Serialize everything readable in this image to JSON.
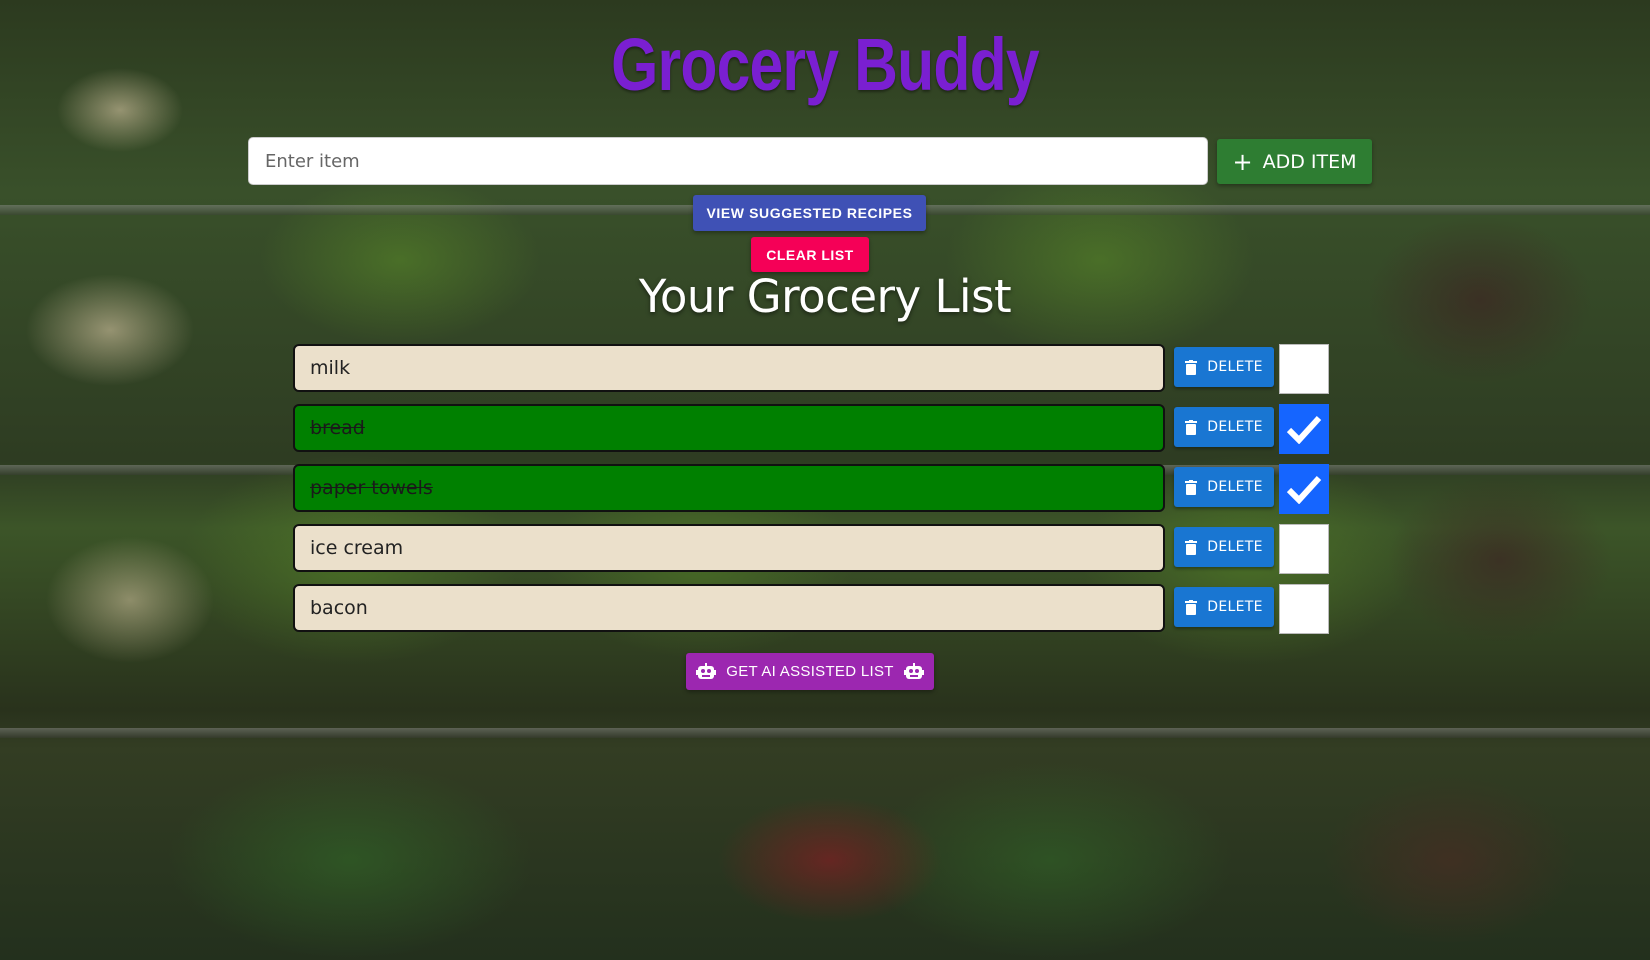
{
  "app": {
    "title": "Grocery Buddy"
  },
  "input": {
    "placeholder": "Enter item",
    "value": ""
  },
  "buttons": {
    "add_item": "ADD ITEM",
    "view_recipes": "VIEW SUGGESTED RECIPES",
    "clear_list": "CLEAR LIST",
    "ai_list": "GET AI ASSISTED LIST"
  },
  "list": {
    "heading": "Your Grocery List",
    "delete_label": "DELETE",
    "items": [
      {
        "name": "milk",
        "checked": false
      },
      {
        "name": "bread",
        "checked": true
      },
      {
        "name": "paper towels",
        "checked": true
      },
      {
        "name": "ice cream",
        "checked": false
      },
      {
        "name": "bacon",
        "checked": false
      }
    ]
  },
  "icons": {
    "add": "plus-icon",
    "delete": "trash-icon",
    "check": "checkmark-icon",
    "ai": "robot-icon"
  },
  "colors": {
    "title": "#7a1fd1",
    "add_button": "#2e7d32",
    "recipes_button": "#3f51b5",
    "clear_button": "#f50057",
    "delete_button": "#1976d2",
    "ai_button": "#9c27b0",
    "item_done": "#008000",
    "item_default": "#ebe0cb",
    "checkbox_checked": "#1565ff"
  }
}
